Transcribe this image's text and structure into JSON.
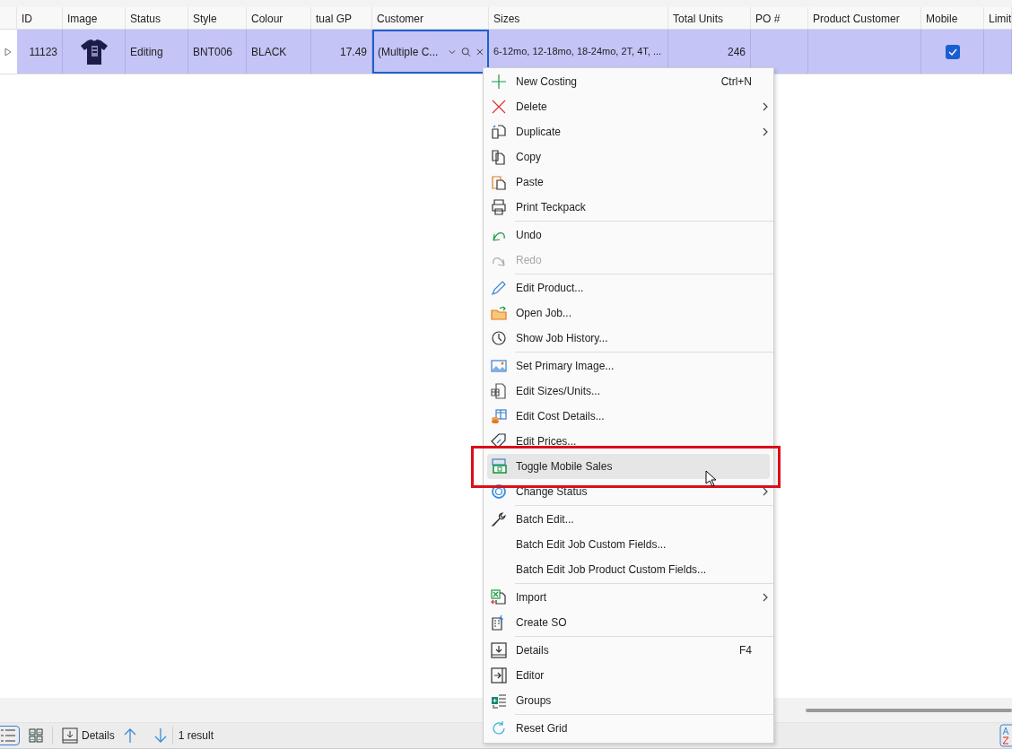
{
  "table": {
    "columns": [
      "ID",
      "Image",
      "Status",
      "Style",
      "Colour",
      "tual GP",
      "Customer",
      "Sizes",
      "Total Units",
      "PO #",
      "Product Customer",
      "Mobile",
      "Limit"
    ],
    "rows": [
      {
        "selected": true,
        "id": "11123",
        "status": "Editing",
        "style": "BNT006",
        "colour": "BLACK",
        "actual_gp": "17.49",
        "customer": "(Multiple C...",
        "sizes": "6-12mo, 12-18mo, 18-24mo, 2T, 4T, ...",
        "total_units": "246",
        "mobile": true
      }
    ]
  },
  "context_menu": {
    "items": [
      {
        "kind": "item",
        "label": "New Costing",
        "shortcut": "Ctrl+N",
        "selected": false,
        "disabled": false
      },
      {
        "kind": "item",
        "label": "Delete",
        "submenu": true,
        "selected": false,
        "disabled": false
      },
      {
        "kind": "item",
        "label": "Duplicate",
        "submenu": true,
        "selected": false,
        "disabled": false
      },
      {
        "kind": "item",
        "label": "Copy",
        "selected": false,
        "disabled": false
      },
      {
        "kind": "item",
        "label": "Paste",
        "selected": false,
        "disabled": false
      },
      {
        "kind": "item",
        "label": "Print Teckpack",
        "selected": false,
        "disabled": false
      },
      {
        "kind": "separator"
      },
      {
        "kind": "item",
        "label": "Undo",
        "selected": false,
        "disabled": false
      },
      {
        "kind": "item",
        "label": "Redo",
        "selected": false,
        "disabled": true
      },
      {
        "kind": "separator"
      },
      {
        "kind": "item",
        "label": "Edit Product...",
        "selected": false,
        "disabled": false
      },
      {
        "kind": "item",
        "label": "Open Job...",
        "selected": false,
        "disabled": false
      },
      {
        "kind": "item",
        "label": "Show Job History...",
        "selected": false,
        "disabled": false
      },
      {
        "kind": "separator"
      },
      {
        "kind": "item",
        "label": "Set Primary Image...",
        "selected": false,
        "disabled": false
      },
      {
        "kind": "item",
        "label": "Edit Sizes/Units...",
        "selected": false,
        "disabled": false
      },
      {
        "kind": "item",
        "label": "Edit Cost Details...",
        "selected": false,
        "disabled": false
      },
      {
        "kind": "item",
        "label": "Edit Prices...",
        "selected": false,
        "disabled": false
      },
      {
        "kind": "item",
        "label": "Toggle Mobile Sales",
        "selected": true,
        "disabled": false
      },
      {
        "kind": "item",
        "label": "Change Status",
        "submenu": true,
        "selected": false,
        "disabled": false
      },
      {
        "kind": "separator"
      },
      {
        "kind": "item",
        "label": "Batch Edit...",
        "selected": false,
        "disabled": false
      },
      {
        "kind": "item",
        "label": "Batch Edit Job Custom Fields...",
        "selected": false,
        "disabled": false
      },
      {
        "kind": "item",
        "label": "Batch Edit Job Product Custom Fields...",
        "selected": false,
        "disabled": false
      },
      {
        "kind": "separator"
      },
      {
        "kind": "item",
        "label": "Import",
        "submenu": true,
        "selected": false,
        "disabled": false
      },
      {
        "kind": "item",
        "label": "Create SO",
        "selected": false,
        "disabled": false
      },
      {
        "kind": "separator"
      },
      {
        "kind": "item",
        "label": "Details",
        "shortcut": "F4",
        "selected": false,
        "disabled": false
      },
      {
        "kind": "item",
        "label": "Editor",
        "selected": false,
        "disabled": false
      },
      {
        "kind": "item",
        "label": "Groups",
        "selected": false,
        "disabled": false
      },
      {
        "kind": "separator"
      },
      {
        "kind": "item",
        "label": "Reset Grid",
        "selected": false,
        "disabled": false
      }
    ]
  },
  "toolbar": {
    "list_view_selected": true,
    "details_label": "Details",
    "result_count": "1 result"
  }
}
